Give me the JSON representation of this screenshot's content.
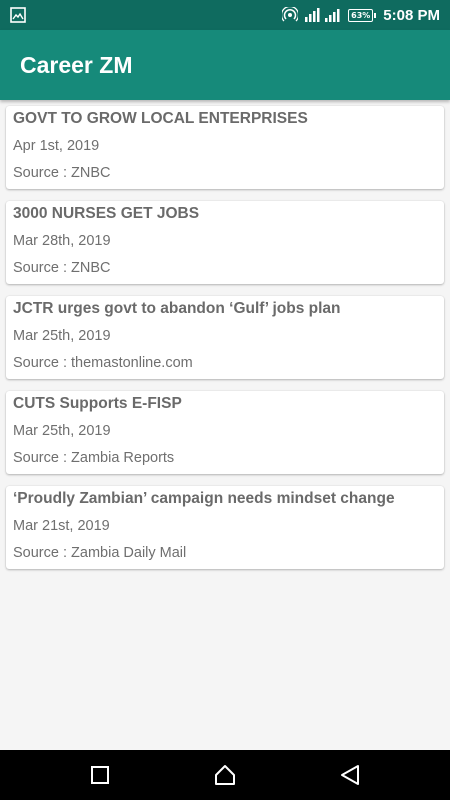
{
  "status_bar": {
    "time": "5:08 PM",
    "battery": "63%",
    "icons": [
      "image-icon",
      "hotspot-icon",
      "signal-icon",
      "battery-icon"
    ]
  },
  "app_bar": {
    "title": "Career ZM"
  },
  "news": [
    {
      "title": "GOVT TO GROW LOCAL ENTERPRISES",
      "date": "Apr 1st, 2019",
      "source": "Source :  ZNBC"
    },
    {
      "title": "3000 NURSES GET JOBS",
      "date": "Mar 28th, 2019",
      "source": "Source :  ZNBC"
    },
    {
      "title": "JCTR urges govt to abandon ‘Gulf’ jobs plan",
      "date": "Mar 25th, 2019",
      "source": "Source :  themastonline.com"
    },
    {
      "title": "CUTS Supports E-FISP",
      "date": "Mar 25th, 2019",
      "source": "Source :  Zambia Reports"
    },
    {
      "title": "‘Proudly Zambian’ campaign needs mindset change",
      "date": "Mar 21st, 2019",
      "source": "Source :  Zambia Daily Mail"
    }
  ],
  "nav_bar": {
    "buttons": [
      "recents-icon",
      "home-icon",
      "back-icon"
    ]
  },
  "colors": {
    "status_bar": "#0f6b5f",
    "app_bar": "#168a7a",
    "background": "#f5f5f5",
    "text": "#6a6a6a"
  }
}
